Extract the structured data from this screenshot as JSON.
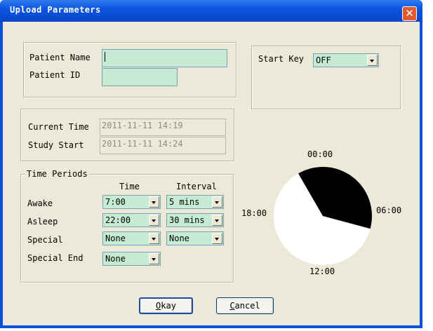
{
  "window": {
    "title": "Upload Parameters",
    "close_glyph": "✕"
  },
  "patient": {
    "name_label": "Patient Name",
    "name_value": "",
    "id_label": "Patient ID",
    "id_value": ""
  },
  "start_key": {
    "label": "Start Key",
    "value": "OFF"
  },
  "times": {
    "current_label": "Current Time",
    "current_value": "2011-11-11 14:19",
    "study_label": "Study Start",
    "study_value": "2011-11-11 14:24"
  },
  "periods": {
    "legend": "Time Periods",
    "col_time": "Time",
    "col_interval": "Interval",
    "rows": [
      {
        "label": "Awake",
        "time": "7:00",
        "interval": "5 mins"
      },
      {
        "label": "Asleep",
        "time": "22:00",
        "interval": "30 mins"
      },
      {
        "label": "Special",
        "time": "None",
        "interval": "None"
      },
      {
        "label": "Special End",
        "time": "None"
      }
    ]
  },
  "clock": {
    "labels": {
      "top": "00:00",
      "right": "06:00",
      "bottom": "12:00",
      "left": "18:00"
    },
    "asleep_from_hour": 22,
    "asleep_to_hour": 7,
    "colors": {
      "asleep": "#000000",
      "awake": "#ffffff"
    }
  },
  "buttons": {
    "ok_first": "O",
    "ok_rest": "kay",
    "cancel_first": "C",
    "cancel_rest": "ancel"
  }
}
